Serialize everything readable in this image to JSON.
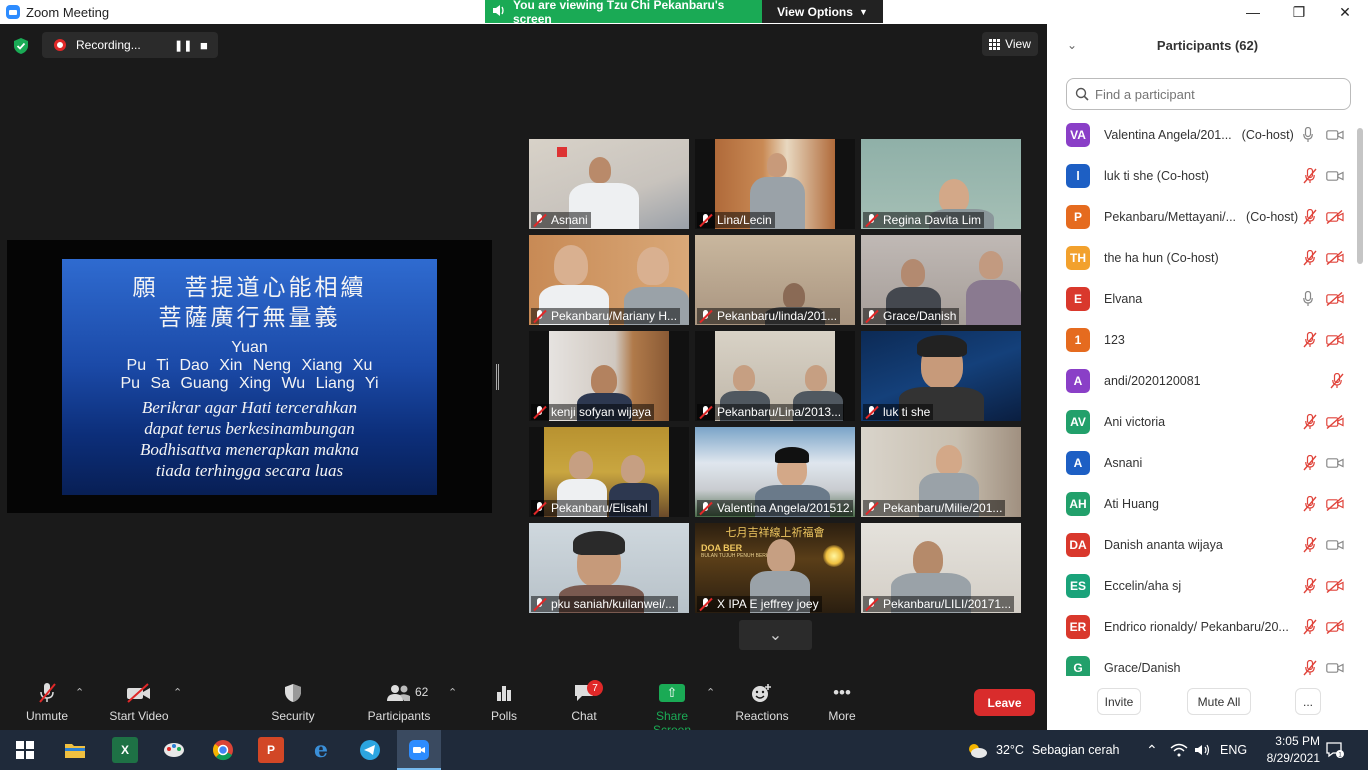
{
  "window": {
    "title": "Zoom Meeting",
    "viewing_banner": "You are viewing Tzu Chi Pekanbaru's screen",
    "view_options": "View Options"
  },
  "recording": {
    "label": "Recording..."
  },
  "view_button": {
    "label": "View"
  },
  "shared_slide": {
    "line1": "願　菩提道心能相續",
    "line2": "菩薩廣行無量義",
    "line3": "Yuan",
    "line4": "Pu Ti Dao Xin Neng Xiang Xu",
    "line5": "Pu Sa Guang Xing Wu Liang Yi",
    "line6": "Berikrar agar Hati tercerahkan",
    "line7": "dapat terus berkesinambungan",
    "line8": "Bodhisattva menerapkan makna",
    "line9": "tiada terhingga secara luas"
  },
  "tiles": [
    {
      "name": "Asnani"
    },
    {
      "name": "Lina/Lecin"
    },
    {
      "name": "Regina Davita Lim"
    },
    {
      "name": "Pekanbaru/Mariany H..."
    },
    {
      "name": "Pekanbaru/linda/201..."
    },
    {
      "name": "Grace/Danish"
    },
    {
      "name": "kenji sofyan wijaya"
    },
    {
      "name": "Pekanbaru/Lina/2013..."
    },
    {
      "name": "luk ti she"
    },
    {
      "name": "Pekanbaru/Elisahl"
    },
    {
      "name": "Valentina Angela/201512..."
    },
    {
      "name": "Pekanbaru/Milie/201..."
    },
    {
      "name": "pku saniah/kuilanwei/..."
    },
    {
      "name": "X IPA E jeffrey joey"
    },
    {
      "name": "Pekanbaru/LILI/20171..."
    }
  ],
  "tile_overlay": {
    "banner_title": "七月吉祥線上祈福會",
    "doa": "DOA BER",
    "bulan": "BULAN TUJUH PENUH BERKAH"
  },
  "toolbar": {
    "unmute": "Unmute",
    "start_video": "Start Video",
    "security": "Security",
    "participants": "Participants",
    "participants_count": "62",
    "polls": "Polls",
    "chat": "Chat",
    "chat_badge": "7",
    "share_screen": "Share Screen",
    "reactions": "Reactions",
    "more": "More",
    "leave": "Leave"
  },
  "panel": {
    "title": "Participants (62)",
    "search_placeholder": "Find a participant",
    "invite": "Invite",
    "mute_all": "Mute All",
    "more": "...",
    "participants": [
      {
        "initials": "VA",
        "name": "Valentina Angela/201...",
        "role": "(Co-host)",
        "color": "#8a3fc7",
        "mic": "on",
        "cam": "on"
      },
      {
        "initials": "l",
        "name": "luk ti she (Co-host)",
        "role": "",
        "color": "#1d5fc4",
        "mic": "off",
        "cam": "on"
      },
      {
        "initials": "P",
        "name": "Pekanbaru/Mettayani/...",
        "role": "(Co-host)",
        "color": "#e56b1f",
        "mic": "off",
        "cam": "off"
      },
      {
        "initials": "TH",
        "name": "the ha hun (Co-host)",
        "role": "",
        "color": "#f2a12d",
        "mic": "off",
        "cam": "off"
      },
      {
        "initials": "E",
        "name": "Elvana",
        "role": "",
        "color": "#d9382c",
        "mic": "on",
        "cam": "off"
      },
      {
        "initials": "1",
        "name": "123",
        "role": "",
        "color": "#e56b1f",
        "mic": "off",
        "cam": "off"
      },
      {
        "initials": "A",
        "name": "andi/2020120081",
        "role": "",
        "color": "#8a3fc7",
        "mic": "off",
        "cam": "none"
      },
      {
        "initials": "AV",
        "name": "Ani victoria",
        "role": "",
        "color": "#22a06b",
        "mic": "off",
        "cam": "off"
      },
      {
        "initials": "A",
        "name": "Asnani",
        "role": "",
        "color": "#1d5fc4",
        "mic": "off",
        "cam": "on"
      },
      {
        "initials": "AH",
        "name": "Ati Huang",
        "role": "",
        "color": "#22a06b",
        "mic": "off",
        "cam": "off"
      },
      {
        "initials": "DA",
        "name": "Danish ananta wijaya",
        "role": "",
        "color": "#d9382c",
        "mic": "off",
        "cam": "on"
      },
      {
        "initials": "ES",
        "name": "Eccelin/aha sj",
        "role": "",
        "color": "#1aa37a",
        "mic": "off",
        "cam": "off"
      },
      {
        "initials": "ER",
        "name": "Endrico rionaldy/ Pekanbaru/20...",
        "role": "",
        "color": "#d9382c",
        "mic": "off",
        "cam": "off"
      },
      {
        "initials": "G",
        "name": "Grace/Danish",
        "role": "",
        "color": "#22a06b",
        "mic": "off",
        "cam": "on"
      }
    ]
  },
  "taskbar": {
    "temperature": "32°C",
    "weather": "Sebagian cerah",
    "language": "ENG",
    "time": "3:05 PM",
    "date": "8/29/2021"
  }
}
